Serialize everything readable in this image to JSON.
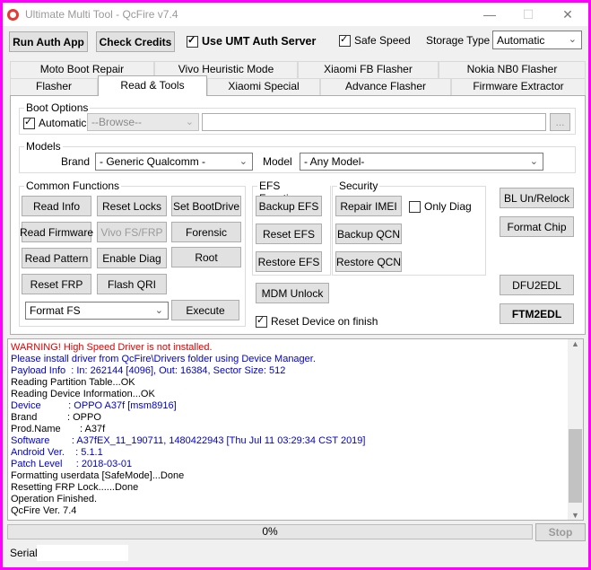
{
  "window": {
    "title": "Ultimate Multi Tool - QcFire v7.4",
    "minimize": "—",
    "maximize": "☐",
    "close": "✕"
  },
  "toolbar": {
    "run_auth": "Run Auth App",
    "check_credits": "Check Credits",
    "use_umt_auth": "Use UMT Auth Server",
    "safe_speed": "Safe Speed",
    "storage_type_label": "Storage Type",
    "storage_type_value": "Automatic"
  },
  "tabs_row1": [
    "Moto Boot Repair",
    "Vivo Heuristic Mode",
    "Xiaomi FB Flasher",
    "Nokia NB0 Flasher"
  ],
  "tabs_row2": [
    "Flasher",
    "Read & Tools",
    "Xiaomi Special",
    "Advance Flasher",
    "Firmware Extractor"
  ],
  "boot_options": {
    "title": "Boot Options",
    "automatic": "Automatic",
    "browse": "--Browse--",
    "ellipsis": "..."
  },
  "models": {
    "title": "Models",
    "brand_label": "Brand",
    "brand_value": "- Generic Qualcomm -",
    "model_label": "Model",
    "model_value": "- Any Model-"
  },
  "common": {
    "title": "Common Functions",
    "read_info": "Read Info",
    "reset_locks": "Reset Locks",
    "set_bootdrive": "Set BootDrive",
    "read_firmware": "Read Firmware",
    "vivo_fs_frp": "Vivo FS/FRP",
    "forensic": "Forensic",
    "read_pattern": "Read Pattern",
    "enable_diag": "Enable Diag",
    "root": "Root",
    "reset_frp": "Reset FRP",
    "flash_qri": "Flash QRI",
    "format_select": "Format FS",
    "execute": "Execute"
  },
  "efs": {
    "title": "EFS Functions",
    "backup": "Backup EFS",
    "reset": "Reset EFS",
    "restore": "Restore EFS"
  },
  "security": {
    "title": "Security",
    "repair_imei": "Repair IMEI",
    "only_diag": "Only Diag",
    "backup_qcn": "Backup QCN",
    "restore_qcn": "Restore QCN"
  },
  "mdm_unlock": "MDM Unlock",
  "reset_device_finish": "Reset Device on finish",
  "side": {
    "bl_unrelock": "BL Un/Relock",
    "format_chip": "Format Chip",
    "dfu2edl": "DFU2EDL",
    "ftm2edl": "FTM2EDL"
  },
  "log": [
    {
      "text": "WARNING! High Speed Driver is not installed.",
      "color": "#e00000"
    },
    {
      "text": "Please install driver from QcFire\\Drivers folder using Device Manager.",
      "color": "#0000cc"
    },
    {
      "text": "Payload Info  : In: 262144 [4096], Out: 16384, Sector Size: 512",
      "color": "#0000cc"
    },
    {
      "text": "Reading Partition Table...OK",
      "color": "#000000"
    },
    {
      "text": "Reading Device Information...OK",
      "color": "#000000"
    },
    {
      "text": "Device          : OPPO A37f [msm8916]",
      "color": "#0000cc"
    },
    {
      "text": "Brand           : OPPO",
      "color": "#000000"
    },
    {
      "text": "Prod.Name       : A37f",
      "color": "#000000"
    },
    {
      "text": "Software        : A37fEX_11_190711, 1480422943 [Thu Jul 11 03:29:34 CST 2019]",
      "color": "#0000cc"
    },
    {
      "text": "Android Ver.    : 5.1.1",
      "color": "#0000cc"
    },
    {
      "text": "Patch Level     : 2018-03-01",
      "color": "#0000cc"
    },
    {
      "text": "Formatting userdata [SafeMode]...Done",
      "color": "#000000"
    },
    {
      "text": "Resetting FRP Lock......Done",
      "color": "#000000"
    },
    {
      "text": "Operation Finished.",
      "color": "#000000"
    },
    {
      "text": "QcFire Ver. 7.4",
      "color": "#000000"
    }
  ],
  "progress": {
    "text": "0%",
    "value": 0
  },
  "stop": "Stop",
  "serial_label": "Serial:"
}
